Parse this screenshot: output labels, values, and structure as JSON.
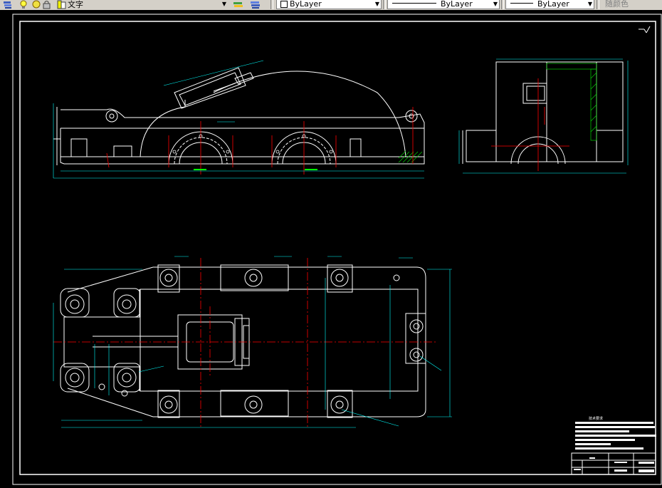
{
  "toolbar": {
    "text_style": "文字",
    "layer": "ByLayer",
    "linetype": "ByLayer",
    "lineweight": "ByLayer",
    "plot_style": "随颜色"
  },
  "titleblock": {
    "heading": "技术要求"
  },
  "colors": {
    "background": "#000000",
    "geometry": "#ffffff",
    "dimension": "#00ffff",
    "centerline": "#ff0000",
    "hatch": "#00cc00",
    "toolbar": "#d4d0c8"
  },
  "icons": [
    "layers-icon",
    "lightbulb-icon",
    "sun-icon",
    "lock-icon",
    "color-swatch-icon",
    "layer-state-icon",
    "layer-previous-icon"
  ]
}
